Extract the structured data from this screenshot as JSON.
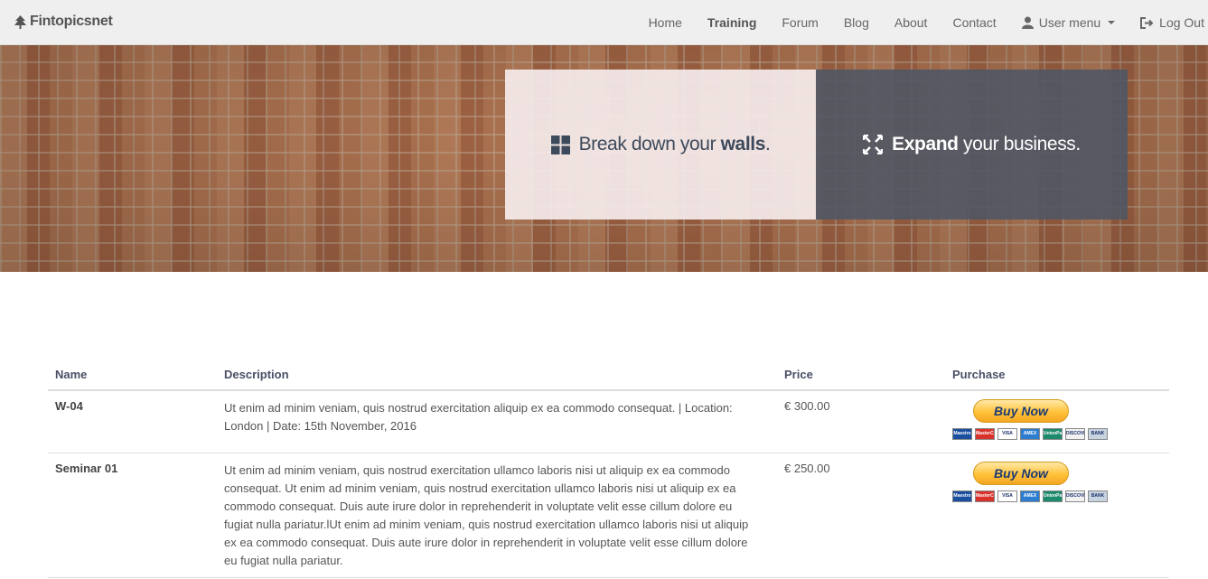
{
  "nav": {
    "brand": "Fintopicsnet",
    "items": [
      {
        "label": "Home"
      },
      {
        "label": "Training"
      },
      {
        "label": "Forum"
      },
      {
        "label": "Blog"
      },
      {
        "label": "About"
      },
      {
        "label": "Contact"
      }
    ],
    "user_menu": "User menu",
    "logout": "Log Out"
  },
  "hero": {
    "left": {
      "pre": "Break down your ",
      "bold": "walls",
      "post": "."
    },
    "right": {
      "bold": "Expand",
      "post": " your business."
    }
  },
  "table": {
    "headers": [
      "Name",
      "Description",
      "Price",
      "Purchase"
    ],
    "rows": [
      {
        "name": "W-04",
        "description": "Ut enim ad minim veniam, quis nostrud exercitation aliquip ex ea commodo consequat. | Location: London | Date: 15th November, 2016",
        "price": "€ 300.00",
        "button": "Buy Now"
      },
      {
        "name": "Seminar 01",
        "description": "Ut enim ad minim veniam, quis nostrud exercitation ullamco laboris nisi ut aliquip ex ea commodo consequat. Ut enim ad minim veniam, quis nostrud exercitation ullamco laboris nisi ut aliquip ex ea commodo consequat. Duis aute irure dolor in reprehenderit in voluptate velit esse cillum dolore eu fugiat nulla pariatur.lUt enim ad minim veniam, quis nostrud exercitation ullamco laboris nisi ut aliquip ex ea commodo consequat. Duis aute irure dolor in reprehenderit in voluptate velit esse cillum dolore eu fugiat nulla pariatur.",
        "price": "€ 250.00",
        "button": "Buy Now"
      }
    ]
  },
  "payment_cards": [
    {
      "label": "Maestro",
      "color": "#1a4fa0"
    },
    {
      "label": "MasterCard",
      "color": "#d9322b"
    },
    {
      "label": "VISA",
      "color": "#ffffff"
    },
    {
      "label": "AMEX",
      "color": "#2c7ccf"
    },
    {
      "label": "UnionPay",
      "color": "#1c8a6d"
    },
    {
      "label": "DISCOVER",
      "color": "#f2f2f2"
    },
    {
      "label": "BANK",
      "color": "#c8d3e0"
    }
  ],
  "colors": {
    "navbar_bg": "#efefef",
    "header_text": "#4a4f66",
    "left_panel": "#f5ebeb",
    "right_panel": "#505664",
    "paypal_blue": "#1c3b75"
  }
}
